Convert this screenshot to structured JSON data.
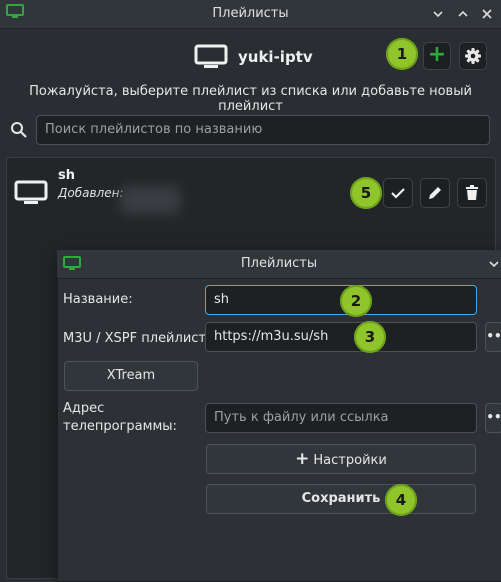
{
  "window": {
    "title": "Плейлисты"
  },
  "header": {
    "app_title": "yuki-iptv",
    "add_glyph": "+",
    "settings_icon": "gear-icon"
  },
  "subtitle": "Пожалуйста, выберите плейлист из списка или добавьте новый плейлист",
  "search": {
    "placeholder": "Поиск плейлистов по названию"
  },
  "playlist_item": {
    "name": "sh",
    "added_label": "Добавлен:"
  },
  "badges": {
    "b1": "1",
    "b2": "2",
    "b3": "3",
    "b4": "4",
    "b5": "5"
  },
  "dialog": {
    "title": "Плейлисты",
    "name_label": "Название:",
    "name_value": "sh",
    "m3u_label": "M3U / XSPF плейлист:",
    "m3u_value": "https://m3u.su/sh",
    "more_glyph": "••",
    "xtream_button": "XTream",
    "epg_label_line1": "Адрес",
    "epg_label_line2": "телепрограммы:",
    "epg_placeholder": "Путь к файлу или ссылка",
    "settings_button": "Настройки",
    "settings_plus": "+",
    "save_button": "Сохранить"
  },
  "colors": {
    "accent_green": "#8fc52a",
    "focus_blue": "#3daee9",
    "icon_green": "#2eaa3c"
  }
}
